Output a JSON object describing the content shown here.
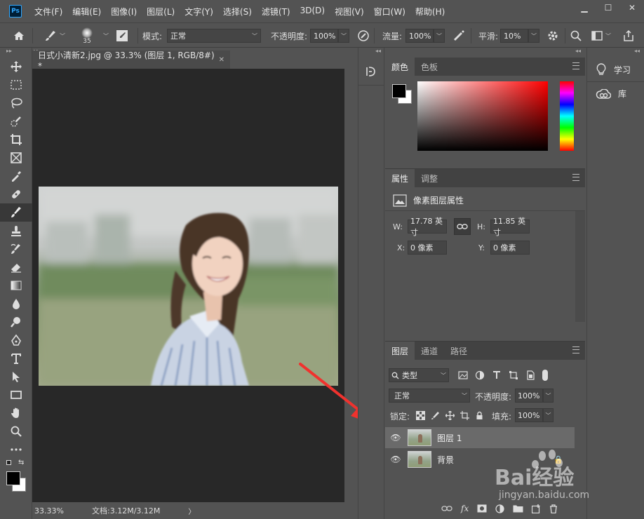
{
  "menubar": {
    "logo": "Ps",
    "items": [
      "文件(F)",
      "编辑(E)",
      "图像(I)",
      "图层(L)",
      "文字(Y)",
      "选择(S)",
      "滤镜(T)",
      "3D(D)",
      "视图(V)",
      "窗口(W)",
      "帮助(H)"
    ]
  },
  "options": {
    "brush_size": "35",
    "mode_label": "模式:",
    "mode_value": "正常",
    "opacity_label": "不透明度:",
    "opacity_value": "100%",
    "flow_label": "流量:",
    "flow_value": "100%",
    "smooth_label": "平滑:",
    "smooth_value": "10%"
  },
  "document": {
    "tab_title": "日式小清新2.jpg @ 33.3% (图层 1, RGB/8#) *",
    "zoom": "33.33%",
    "doc_info": "文档:3.12M/3.12M"
  },
  "color_panel": {
    "tabs": [
      "颜色",
      "色板"
    ],
    "accent": "#ff0000"
  },
  "properties_panel": {
    "tabs": [
      "属性",
      "调整"
    ],
    "title": "像素图层属性",
    "w_label": "W:",
    "w_value": "17.78 英寸",
    "h_label": "H:",
    "h_value": "11.85 英寸",
    "x_label": "X:",
    "x_value": "0 像素",
    "y_label": "Y:",
    "y_value": "0 像素"
  },
  "layers_panel": {
    "tabs": [
      "图层",
      "通道",
      "路径"
    ],
    "filter_label": "类型",
    "blend_mode": "正常",
    "opacity_label": "不透明度:",
    "opacity_value": "100%",
    "lock_label": "锁定:",
    "fill_label": "填充:",
    "fill_value": "100%",
    "layers": [
      {
        "name": "图层 1",
        "selected": true
      },
      {
        "name": "背景",
        "selected": false
      }
    ]
  },
  "right_dock": {
    "learn": "学习",
    "library": "库"
  },
  "watermark": {
    "text": "Bai经验",
    "url": "jingyan.baidu.com"
  }
}
